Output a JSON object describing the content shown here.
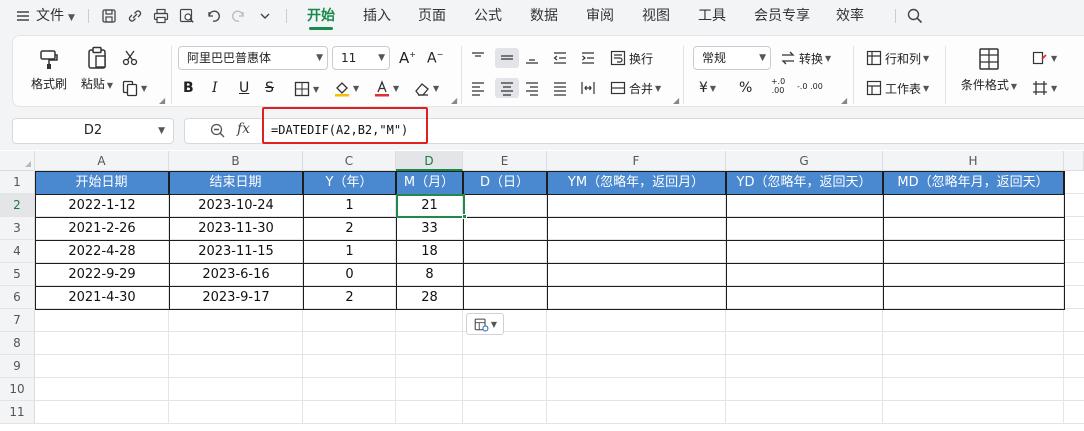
{
  "menu": {
    "file_label": "文件",
    "tabs": [
      "开始",
      "插入",
      "页面",
      "公式",
      "数据",
      "审阅",
      "视图",
      "工具",
      "会员专享",
      "效率"
    ],
    "active_tab": "开始"
  },
  "ribbon": {
    "format_painter": "格式刷",
    "paste": "粘贴",
    "font_name": "阿里巴巴普惠体",
    "font_size": "11",
    "wrap_text": "换行",
    "merge": "合并",
    "number_format": "常规",
    "convert": "转换",
    "rows_cols": "行和列",
    "worksheet": "工作表",
    "conditional_format": "条件格式",
    "bold": "B",
    "italic": "I",
    "underline": "U",
    "currency": "¥",
    "percent": "%",
    "inc_decimal": "+.0 .00",
    "dec_decimal": "-.0 .00"
  },
  "formula_bar": {
    "name_box": "D2",
    "fx": "fx",
    "formula": "=DATEDIF(A2,B2,\"M\")"
  },
  "sheet": {
    "columns": [
      "A",
      "B",
      "C",
      "D",
      "E",
      "F",
      "G",
      "H"
    ],
    "selected_column": "D",
    "rows": [
      "1",
      "2",
      "3",
      "4",
      "5",
      "6",
      "7",
      "8",
      "9",
      "10",
      "11"
    ],
    "selected_row": "2",
    "headers": [
      "开始日期",
      "结束日期",
      "Y（年）",
      "M（月）",
      "D（日）",
      "YM（忽略年，返回月）",
      "YD（忽略年，返回天）",
      "MD（忽略年月，返回天）"
    ],
    "data": [
      [
        "2022-1-12",
        "2023-10-24",
        "1",
        "21"
      ],
      [
        "2021-2-26",
        "2023-11-30",
        "2",
        "33"
      ],
      [
        "2022-4-28",
        "2023-11-15",
        "1",
        "18"
      ],
      [
        "2022-9-29",
        "2023-6-16",
        "0",
        "8"
      ],
      [
        "2021-4-30",
        "2023-9-17",
        "2",
        "28"
      ]
    ],
    "active_cell": "D2"
  },
  "colors": {
    "accent_green": "#1a8a4c",
    "header_fill": "#4a88d0",
    "highlight_border": "#e02020"
  }
}
